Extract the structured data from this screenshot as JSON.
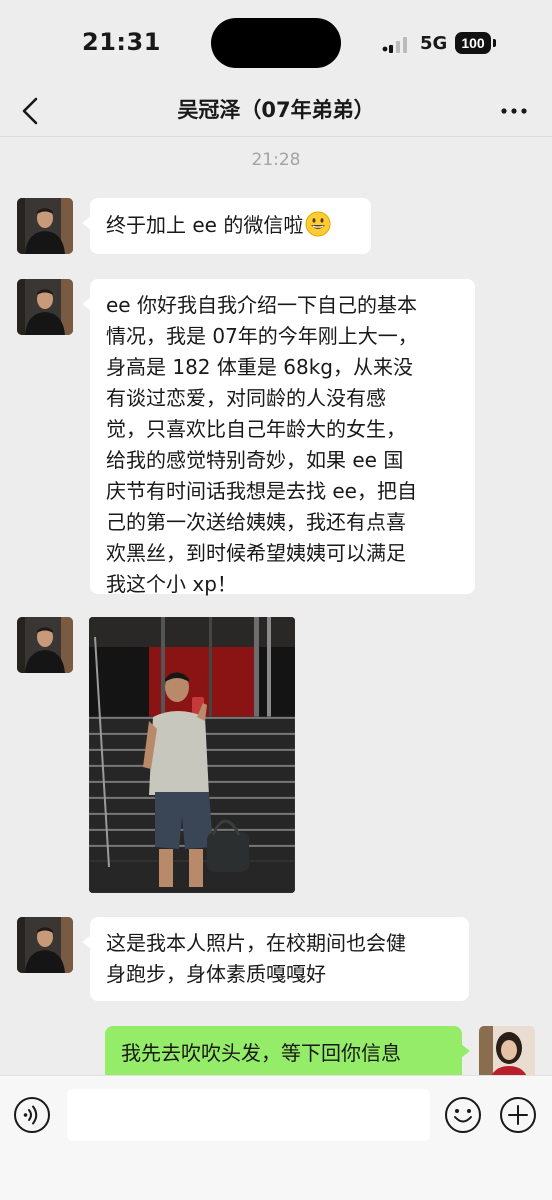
{
  "status_bar": {
    "time": "21:31",
    "network": "5G",
    "battery": "100"
  },
  "nav": {
    "title": "吴冠泽（07年弟弟）",
    "back_icon": "chevron-left-icon",
    "more_icon": "more-dots-icon"
  },
  "chat": {
    "timestamp": "21:28",
    "messages": [
      {
        "sender": "contact",
        "text": "终于加上 ee 的微信啦",
        "emoji": "grinning-face-emoji"
      },
      {
        "sender": "contact",
        "lines": [
          "ee 你好我自我介绍一下自己的基本",
          "情况，我是 07年的今年刚上大一，",
          "身高是 182 体重是 68kg，从来没",
          "有谈过恋爱，对同龄的人没有感",
          "觉，只喜欢比自己年龄大的女生，",
          "给我的感觉特别奇妙，如果 ee 国",
          "庆节有时间话我想是去找 ee，把自",
          "己的第一次送给姨姨，我还有点喜",
          "欢黑丝，到时候希望姨姨可以满足",
          "我这个小 xp！"
        ]
      },
      {
        "sender": "contact",
        "type": "image",
        "description": "photo-message"
      },
      {
        "sender": "contact",
        "lines": [
          "这是我本人照片，在校期间也会健",
          "身跑步，身体素质嘎嘎好"
        ]
      },
      {
        "sender": "me",
        "text": "我先去吹吹头发，等下回你信息"
      }
    ]
  },
  "input_bar": {
    "value": "",
    "voice_icon": "voice-icon",
    "emoji_icon": "emoji-icon",
    "plus_icon": "plus-icon"
  },
  "colors": {
    "background": "#ededed",
    "incoming_bubble": "#ffffff",
    "outgoing_bubble": "#95ec69",
    "timestamp": "#a3a3a3"
  }
}
